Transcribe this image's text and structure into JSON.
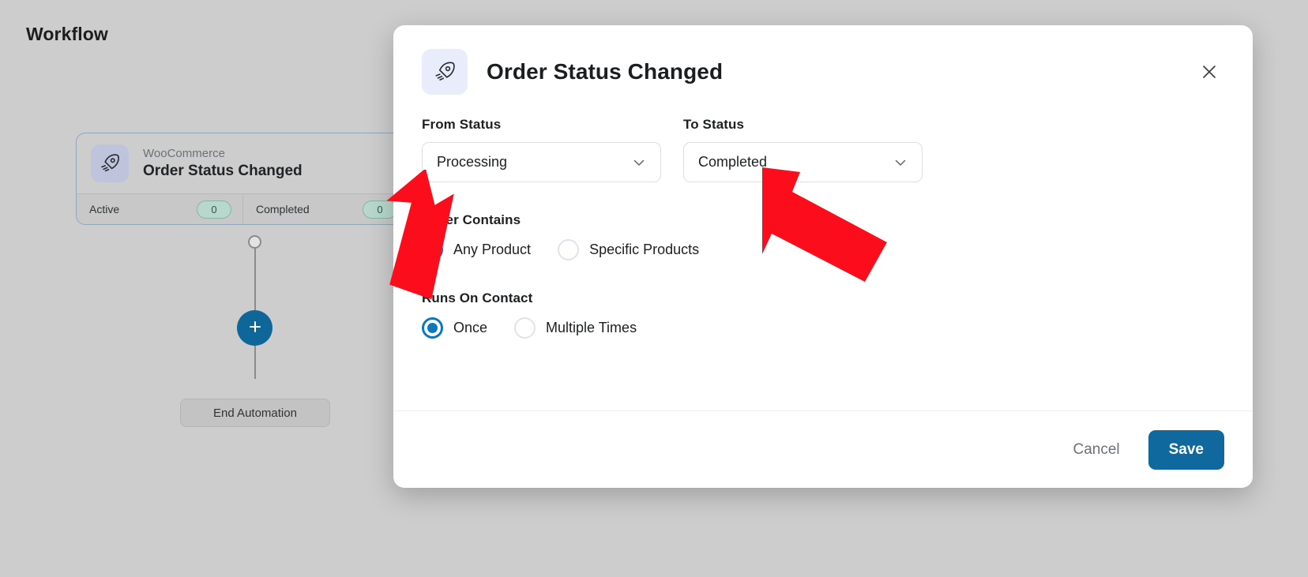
{
  "page": {
    "title": "Workflow",
    "background_color": "#cdcdcd"
  },
  "workflow": {
    "trigger_node": {
      "icon": "rocket-icon",
      "app_name": "WooCommerce",
      "title": "Order Status Changed",
      "stats": [
        {
          "label": "Active",
          "value": "0"
        },
        {
          "label": "Completed",
          "value": "0"
        }
      ]
    },
    "add_step_button_icon": "plus-icon",
    "end_node_label": "End Automation"
  },
  "modal": {
    "icon": "rocket-icon",
    "title": "Order Status Changed",
    "close_icon": "close-icon",
    "fields": {
      "from_status": {
        "label": "From Status",
        "value": "Processing",
        "chevron_icon": "chevron-down-icon"
      },
      "to_status": {
        "label": "To Status",
        "value": "Completed",
        "chevron_icon": "chevron-down-icon"
      }
    },
    "order_contains": {
      "label": "Order Contains",
      "options": [
        {
          "label": "Any Product",
          "selected": true
        },
        {
          "label": "Specific Products",
          "selected": false
        }
      ]
    },
    "runs_on_contact": {
      "label": "Runs On Contact",
      "options": [
        {
          "label": "Once",
          "selected": true
        },
        {
          "label": "Multiple Times",
          "selected": false
        }
      ]
    },
    "footer": {
      "cancel_label": "Cancel",
      "save_label": "Save"
    }
  },
  "colors": {
    "primary_button": "#10699e",
    "radio_accent": "#0b78bd",
    "annotation_arrow": "#fc0d1b",
    "active_pill": "#b8d8cd",
    "node_icon_bg": "#bfc4dd",
    "modal_icon_bg": "#e9ecfa"
  }
}
